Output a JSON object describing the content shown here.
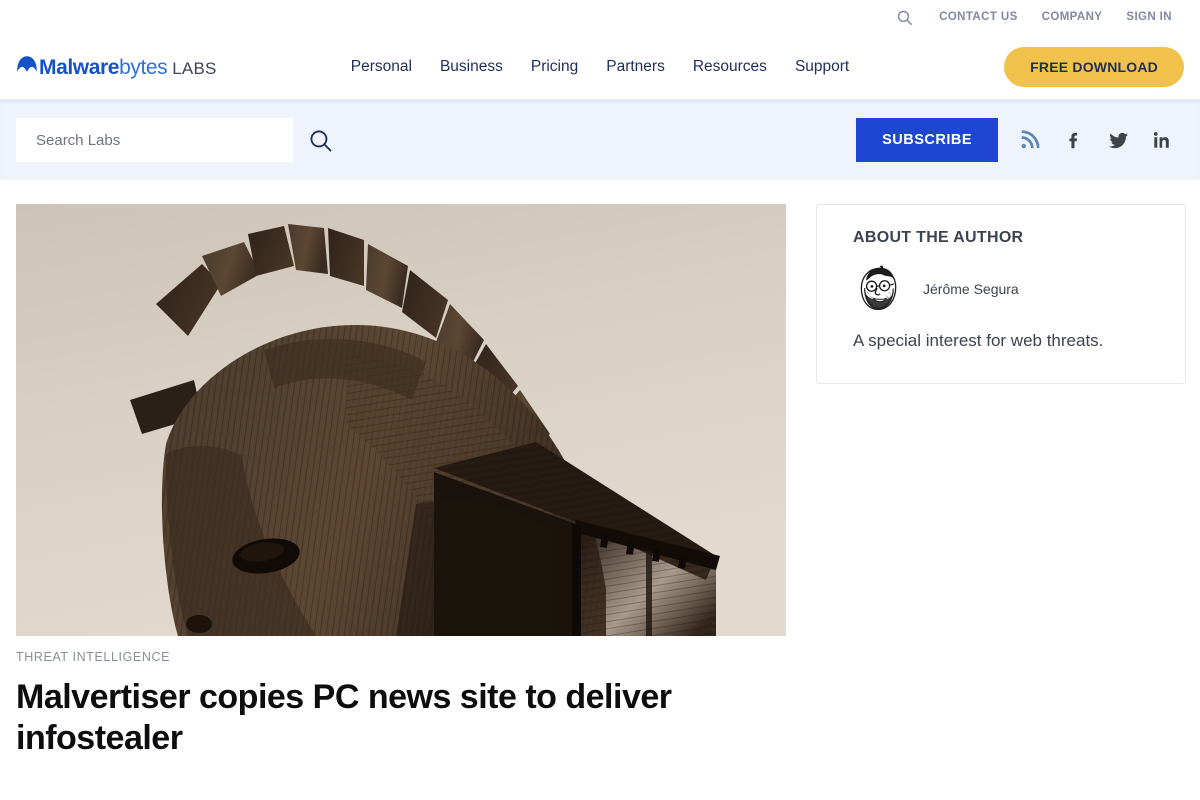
{
  "utility_bar": {
    "search_icon": "search-icon",
    "links": [
      {
        "label": "CONTACT US"
      },
      {
        "label": "COMPANY"
      },
      {
        "label": "SIGN IN"
      }
    ]
  },
  "header": {
    "logo": {
      "part1": "Malware",
      "part2": "bytes",
      "part3": "LABS",
      "mark": "malwarebytes-m-icon"
    },
    "nav": [
      {
        "label": "Personal"
      },
      {
        "label": "Business"
      },
      {
        "label": "Pricing"
      },
      {
        "label": "Partners"
      },
      {
        "label": "Resources"
      },
      {
        "label": "Support"
      }
    ],
    "cta_label": "FREE DOWNLOAD",
    "cta_color": "#f0c24b"
  },
  "labs_band": {
    "search_placeholder": "Search Labs",
    "search_value": "",
    "search_button_icon": "search-icon",
    "subscribe_label": "SUBSCRIBE",
    "subscribe_color": "#1f46d2",
    "social": [
      {
        "name": "rss-icon",
        "color": "#5b87b8"
      },
      {
        "name": "facebook-icon",
        "color": "#3f4348"
      },
      {
        "name": "twitter-icon",
        "color": "#3f4348"
      },
      {
        "name": "linkedin-icon",
        "color": "#3f4348"
      }
    ]
  },
  "article": {
    "hero_image_alt": "Wooden Trojan horse sculpture against a pale sepia sky",
    "category": "THREAT INTELLIGENCE",
    "title": "Malvertiser copies PC news site to deliver infostealer"
  },
  "sidebar": {
    "author_card": {
      "title": "ABOUT THE AUTHOR",
      "avatar_alt": "Cartoon caricature of a bearded man with glasses",
      "name": "Jérôme Segura",
      "bio": "A special interest for web threats."
    }
  }
}
